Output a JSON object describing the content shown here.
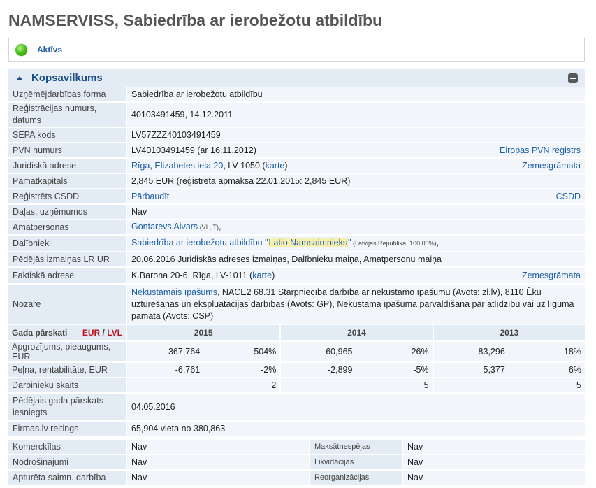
{
  "company": {
    "title": "NAMSERVISS, Sabiedrība ar ierobežotu atbildību",
    "status": "Aktīvs"
  },
  "summary": {
    "title": "Kopsavilkums",
    "rows": {
      "form": {
        "label": "Uzņēmējdarbības forma",
        "value": "Sabiedrība ar ierobežotu atbildību"
      },
      "reg": {
        "label": "Reģistrācijas numurs, datums",
        "value": "40103491459, 14.12.2011"
      },
      "sepa": {
        "label": "SEPA kods",
        "value": "LV57ZZZ40103491459"
      },
      "vat": {
        "label": "PVN numurs",
        "value": "LV40103491459 (ar 16.11.2012)",
        "link": "Eiropas PVN reģistrs"
      },
      "address": {
        "label": "Juridiskā adrese",
        "city": "Rīga",
        "sep1": ", ",
        "street": "Elizabetes iela 20",
        "postal": ", LV-1050 (",
        "map": "karte",
        "close": ")",
        "link": "Zemesgrāmata"
      },
      "capital": {
        "label": "Pamatkapitāls",
        "value": "2,845 EUR (reģistrēta apmaksa 22.01.2015: 2,845 EUR)"
      },
      "csdd": {
        "label": "Reģistrēts CSDD",
        "check": "Pārbaudīt",
        "link": "CSDD"
      },
      "shares": {
        "label": "Daļas, uzņēmumos",
        "value": "Nav"
      },
      "officials": {
        "label": "Amatpersonas",
        "name": "Gontarevs Aivars",
        "note": " (VL, T)",
        "tail": ","
      },
      "members": {
        "label": "Dalībnieki",
        "pre": "Sabiedrība ar ierobežotu atbildību \"",
        "hl": "Latio Namsaimnieks",
        "post": "\"",
        "note": " (Latvijas Republika, 100.00%)",
        "tail": ","
      },
      "changes": {
        "label": "Pēdējās izmaiņas LR UR",
        "value": "20.06.2016 Juridiskās adreses izmaiņas, Dalībnieku maiņa, Amatpersonu maiņa"
      },
      "actual": {
        "label": "Faktiskā adrese",
        "value": "K.Barona 20-6, Rīga, LV-1011 (",
        "map": "karte",
        "close": ")",
        "link": "Zemesgrāmata"
      },
      "industry": {
        "label": "Nozare",
        "link": "Nekustamais īpašums",
        "value": ", NACE2 68.31 Starpniecība darbībā ar nekustamo īpašumu (Avots: zl.lv), 8110 Ēku uzturēšanas un ekspluatācijas darbības (Avots: GP), Nekustamā īpašuma pārvaldīšana par atlīdzību vai uz līguma pamata (Avots: CSP)"
      }
    }
  },
  "annual": {
    "label": "Gada pārskati",
    "cur_eur": "EUR",
    "cur_sep": " / ",
    "cur_lvl": "LVL",
    "years": [
      "2015",
      "2014",
      "2013"
    ],
    "rows": [
      {
        "label": "Apgrozījums, pieaugums, EUR",
        "cells": [
          "367,764",
          "504%",
          "60,965",
          "-26%",
          "83,296",
          "18%"
        ]
      },
      {
        "label": "Peļņa, rentabilitāte, EUR",
        "cells": [
          "-6,761",
          "-2%",
          "-2,899",
          "-5%",
          "5,377",
          "6%"
        ]
      },
      {
        "label": "Darbinieku skaits",
        "cells": [
          "",
          "2",
          "",
          "5",
          "",
          "5"
        ]
      }
    ]
  },
  "last_report": {
    "label": "Pēdējais gada pārskats iesniegts",
    "value": "04.05.2016"
  },
  "rating": {
    "label": "Firmas.lv reitings",
    "value": "65,904 vieta no 380,863"
  },
  "extra": [
    {
      "l1": "Komercķīlas",
      "v1": "Nav",
      "l2": "Maksātnespējas",
      "v2": "Nav"
    },
    {
      "l1": "Nodrošinājumi",
      "v1": "Nav",
      "l2": "Likvidācijas",
      "v2": "Nav"
    },
    {
      "l1": "Apturēta saimn. darbība",
      "v1": "Nav",
      "l2": "Reorganizācijas",
      "v2": "Nav"
    }
  ]
}
